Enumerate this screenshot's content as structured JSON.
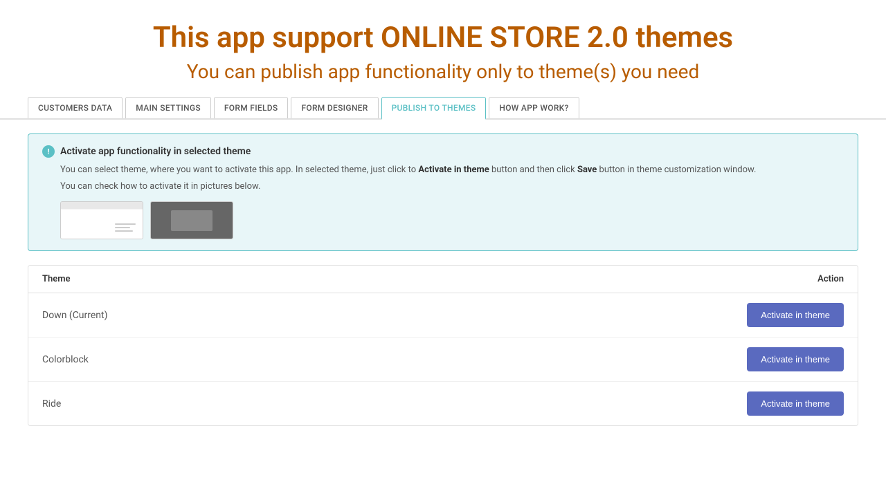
{
  "header": {
    "title_main": "This app support ONLINE STORE 2.0 themes",
    "title_sub": "You can publish app functionality only to theme(s) you need"
  },
  "tabs": [
    {
      "id": "customers-data",
      "label": "CUSTOMERS DATA",
      "active": false
    },
    {
      "id": "main-settings",
      "label": "MAIN SETTINGS",
      "active": false
    },
    {
      "id": "form-fields",
      "label": "FORM FIELDS",
      "active": false
    },
    {
      "id": "form-designer",
      "label": "FORM DESIGNER",
      "active": false
    },
    {
      "id": "publish-to-themes",
      "label": "PUBLISH TO THEMES",
      "active": true
    },
    {
      "id": "how-app-work",
      "label": "HOW APP WORK?",
      "active": false
    }
  ],
  "info_box": {
    "title": "Activate app functionality in selected theme",
    "text1_prefix": "You can select theme, where you want to activate this app. In selected theme, just click to ",
    "text1_bold": "Activate in theme",
    "text1_suffix": " button and then click ",
    "text1_bold2": "Save",
    "text1_suffix2": " button in theme customization window.",
    "text2": "You can check how to activate it in pictures below."
  },
  "table": {
    "col_theme": "Theme",
    "col_action": "Action",
    "rows": [
      {
        "name": "Down (Current)",
        "button_label": "Activate in theme"
      },
      {
        "name": "Colorblock",
        "button_label": "Activate in theme"
      },
      {
        "name": "Ride",
        "button_label": "Activate in theme"
      }
    ]
  }
}
